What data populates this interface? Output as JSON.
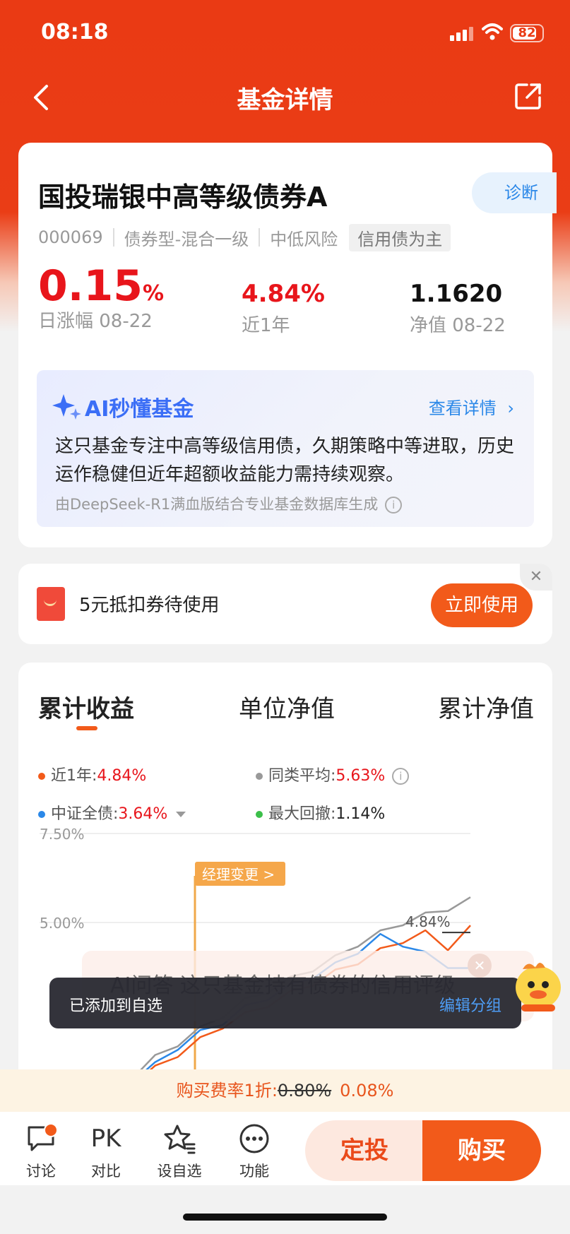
{
  "status_bar": {
    "time": "08:18",
    "battery": "82",
    "battery_level": 0.82
  },
  "nav": {
    "title": "基金详情"
  },
  "fund": {
    "name": "国投瑞银中高等级债券A",
    "diagnose_label": "诊断",
    "code": "000069",
    "type": "债券型-混合一级",
    "risk": "中低风险",
    "focus_tag": "信用债为主",
    "daily_change_value": "0.15",
    "daily_change_unit": "%",
    "daily_change_label": "日涨幅 08-22",
    "year_return_value": "4.84%",
    "year_return_label": "近1年",
    "nav_value": "1.1620",
    "nav_label": "净值 08-22"
  },
  "ai_summary": {
    "title": "AI秒懂基金",
    "more_label": "查看详情",
    "text": "这只基金专注中高等级信用债，久期策略中等进取，历史运作稳健但近年超额收益能力需持续观察。",
    "footnote": "由DeepSeek-R1满血版结合专业基金数据库生成"
  },
  "coupon": {
    "text": "5元抵扣券待使用",
    "button_label": "立即使用"
  },
  "chart_section": {
    "tabs": [
      "累计收益",
      "单位净值",
      "累计净值"
    ],
    "active_tab": 0,
    "legend": [
      {
        "label": "近1年:",
        "value": "4.84%",
        "color": "#f25a1a",
        "value_color": "red"
      },
      {
        "label": "同类平均:",
        "value": "5.63%",
        "color": "#999999",
        "value_color": "red"
      },
      {
        "label": "中证全债:",
        "value": "3.64%",
        "color": "#2b88e8",
        "value_color": "red"
      },
      {
        "label": "最大回撤:",
        "value": "1.14%",
        "color": "#3cbf4a",
        "value_color": "dark"
      }
    ],
    "annotation": "经理变更 >",
    "overlay_text": "AI问答 这只基金持有债券的信用评级"
  },
  "chart_data": {
    "type": "line",
    "yticks": [
      "7.50%",
      "5.00%"
    ],
    "ylim": [
      0,
      7.5
    ],
    "end_label": "4.84%",
    "series": [
      {
        "name": "近1年",
        "color": "#f25a1a",
        "values": [
          0.1,
          0.5,
          0.9,
          1.3,
          1.7,
          2.1,
          2.4,
          2.7,
          3.0,
          3.3,
          3.6,
          3.9,
          4.2,
          4.5,
          4.7,
          4.3,
          4.84
        ]
      },
      {
        "name": "同类平均",
        "color": "#999999",
        "values": [
          0.2,
          0.7,
          1.2,
          1.6,
          2.0,
          2.4,
          2.8,
          3.1,
          3.4,
          3.7,
          4.0,
          4.4,
          4.7,
          5.0,
          5.2,
          5.4,
          5.63
        ]
      },
      {
        "name": "中证全债",
        "color": "#2b88e8",
        "values": [
          0.1,
          0.6,
          1.0,
          1.5,
          1.9,
          2.2,
          2.6,
          2.9,
          3.2,
          3.5,
          3.8,
          4.2,
          4.6,
          4.4,
          4.1,
          3.8,
          3.64
        ]
      }
    ]
  },
  "toast": {
    "text": "已添加到自选",
    "action": "编辑分组"
  },
  "fee": {
    "prefix": "购买费率1折:",
    "old": "0.80%",
    "new": "0.08%"
  },
  "bottom_bar": {
    "items": [
      {
        "label": "讨论",
        "icon": "chat-bubble-icon"
      },
      {
        "label": "对比",
        "icon": "pk-icon",
        "icon_text": "PK"
      },
      {
        "label": "设自选",
        "icon": "star-list-icon"
      },
      {
        "label": "功能",
        "icon": "more-dots-icon"
      }
    ],
    "dingtou_label": "定投",
    "buy_label": "购买"
  }
}
